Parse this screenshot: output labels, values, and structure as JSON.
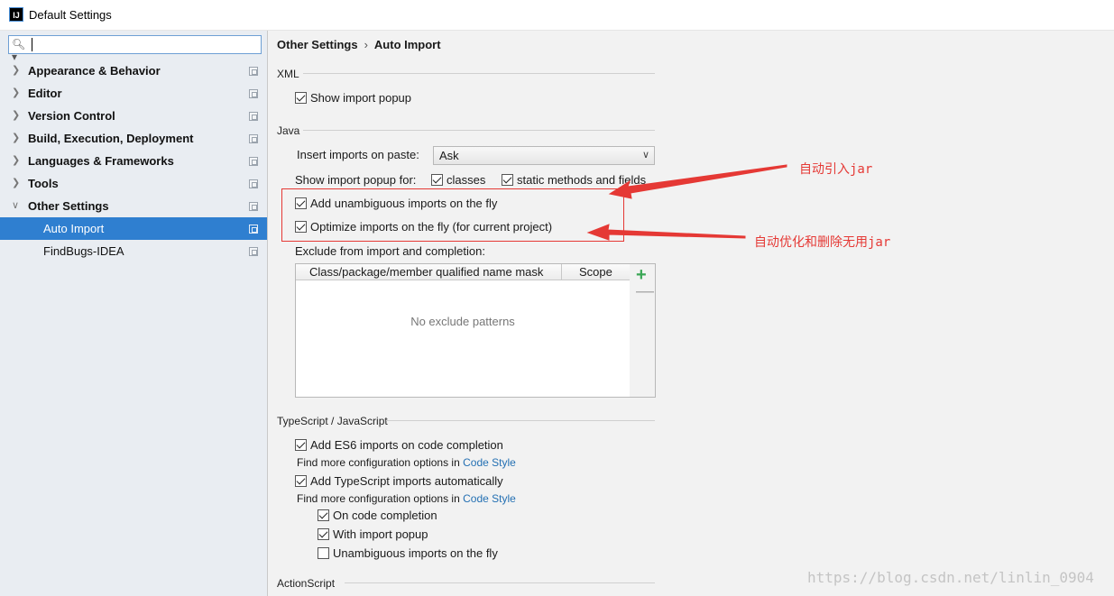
{
  "window": {
    "title": "Default Settings",
    "icon": "intellij-icon"
  },
  "sidebar": {
    "search": {
      "value": "",
      "placeholder": ""
    },
    "items": [
      {
        "label": "Appearance & Behavior",
        "expanded": false
      },
      {
        "label": "Editor",
        "expanded": false
      },
      {
        "label": "Version Control",
        "expanded": false
      },
      {
        "label": "Build, Execution, Deployment",
        "expanded": false
      },
      {
        "label": "Languages & Frameworks",
        "expanded": false
      },
      {
        "label": "Tools",
        "expanded": false
      },
      {
        "label": "Other Settings",
        "expanded": true
      },
      {
        "label": "Auto Import",
        "selected": true
      },
      {
        "label": "FindBugs-IDEA"
      }
    ]
  },
  "breadcrumb": {
    "parent": "Other Settings",
    "separator": "›",
    "current": "Auto Import"
  },
  "xml": {
    "title": "XML",
    "show_import_popup": {
      "label": "Show import popup",
      "checked": true
    }
  },
  "java": {
    "title": "Java",
    "insert_imports_label": "Insert imports on paste:",
    "insert_imports_value": "Ask",
    "show_popup_for_label": "Show import popup for:",
    "classes": {
      "label": "classes",
      "checked": true
    },
    "static_methods": {
      "label": "static methods and fields",
      "checked": true
    },
    "add_unambiguous": {
      "label": "Add unambiguous imports on the fly",
      "checked": true
    },
    "optimize_imports": {
      "label": "Optimize imports on the fly (for current project)",
      "checked": true
    },
    "exclude_label": "Exclude from import and completion:",
    "table": {
      "columns": [
        "Class/package/member qualified name mask",
        "Scope"
      ],
      "empty_text": "No exclude patterns",
      "add": "+",
      "remove": "—"
    }
  },
  "typescript": {
    "title": "TypeScript / JavaScript",
    "es6_imports": {
      "label": "Add ES6 imports on code completion",
      "checked": true
    },
    "find_more_1": "Find more configuration options in ",
    "code_style_1": "Code Style",
    "ts_imports": {
      "label": "Add TypeScript imports automatically",
      "checked": true
    },
    "find_more_2": "Find more configuration options in ",
    "code_style_2": "Code Style",
    "on_code_completion": {
      "label": "On code completion",
      "checked": true
    },
    "with_import_popup": {
      "label": "With import popup",
      "checked": true
    },
    "unambiguous_fly": {
      "label": "Unambiguous imports on the fly",
      "checked": false
    }
  },
  "actionscript": {
    "title": "ActionScript"
  },
  "annotations": {
    "auto_import_jar": "自动引入jar",
    "auto_optimize_jar": "自动优化和删除无用jar",
    "color": "#e53935"
  },
  "watermark": "https://blog.csdn.net/linlin_0904",
  "colors": {
    "selection": "#2f7fd0",
    "link": "#2470b3",
    "add": "#3aa655"
  }
}
